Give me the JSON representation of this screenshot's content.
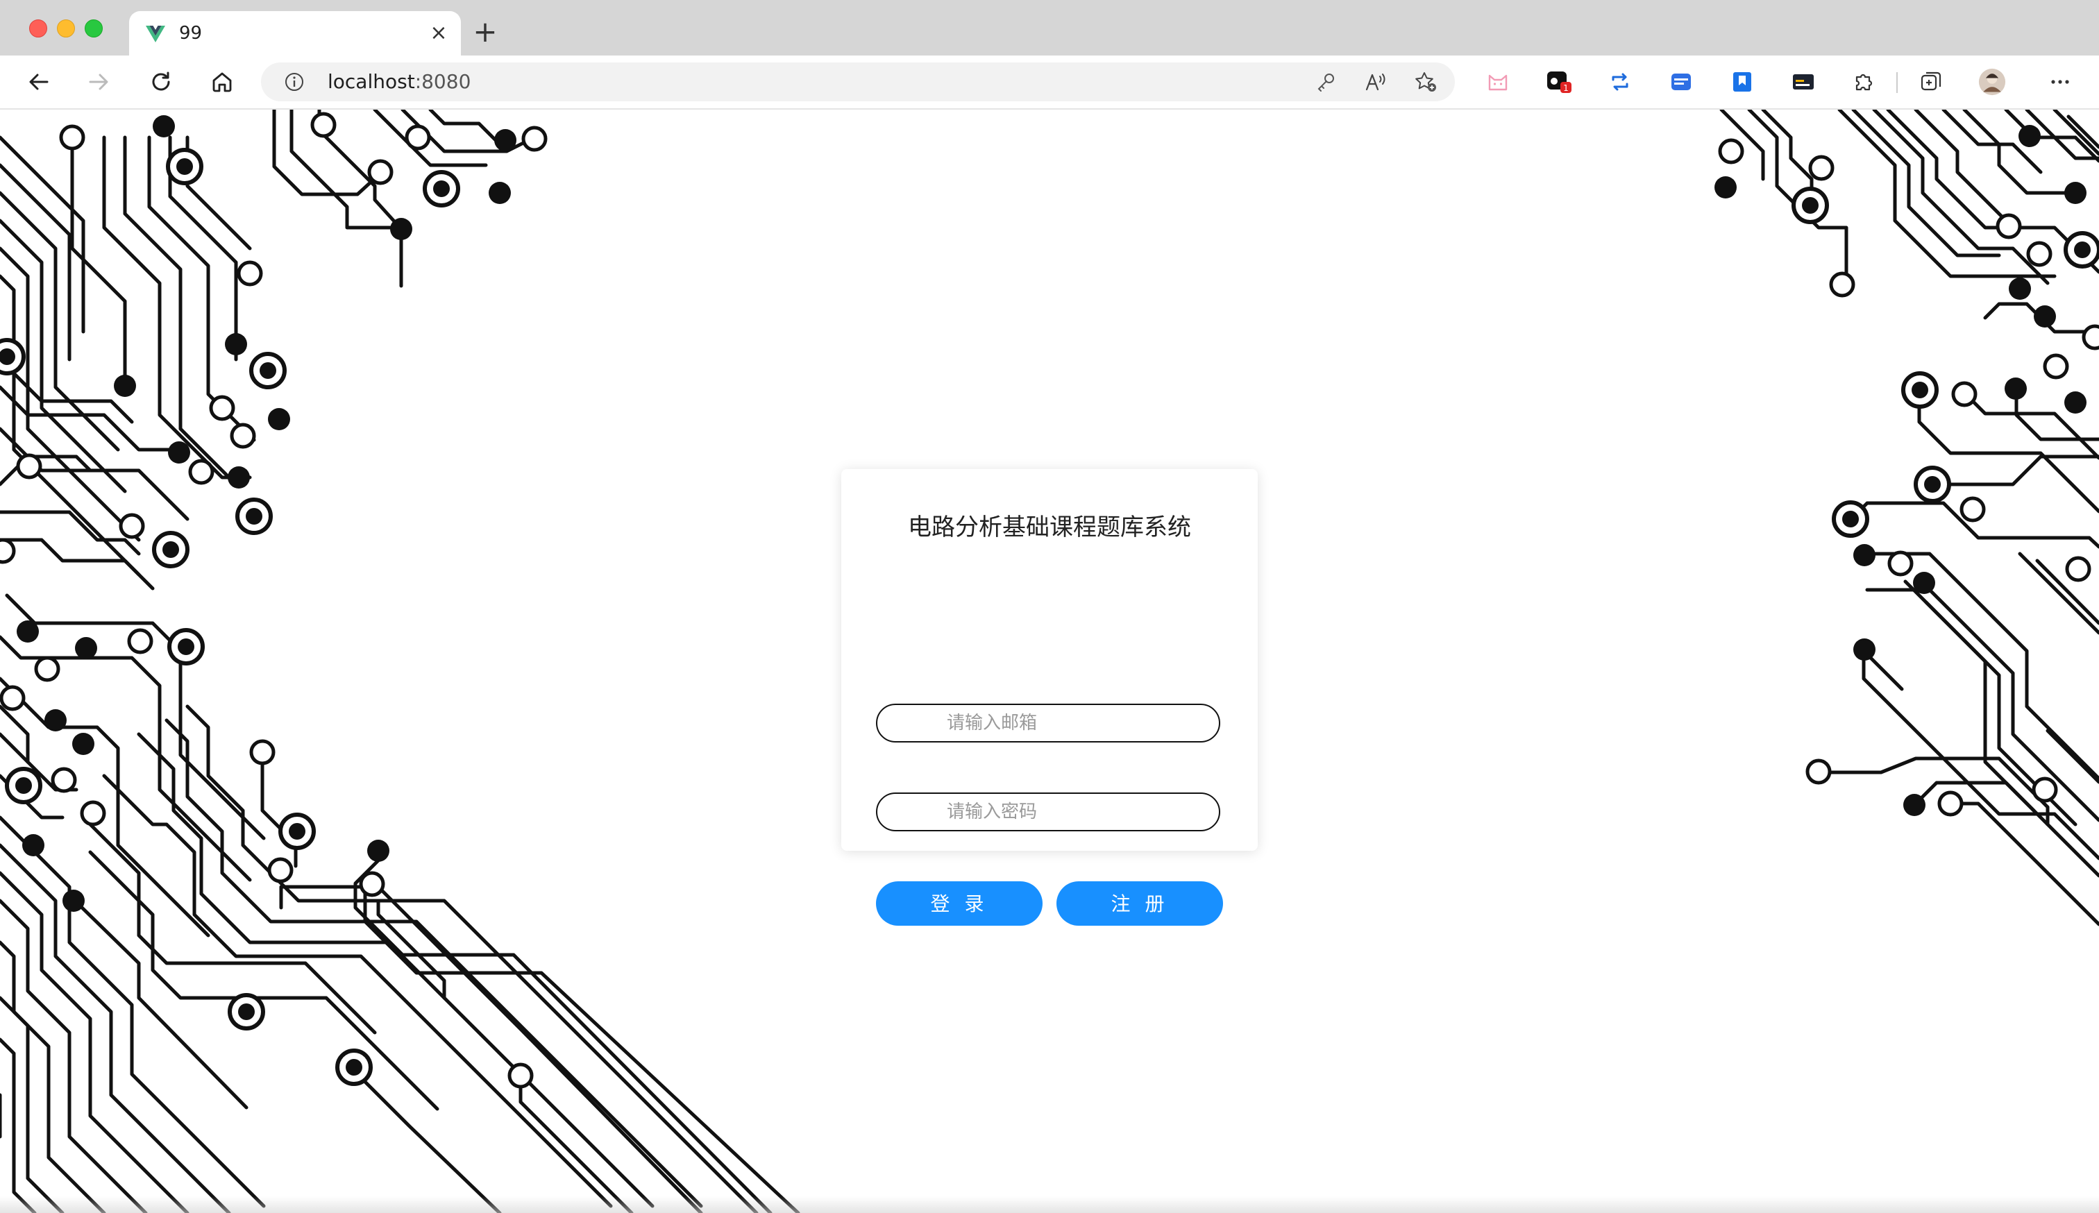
{
  "browser": {
    "tab": {
      "title": "99",
      "close_symbol": "×",
      "favicon": "vue-logo-icon"
    },
    "new_tab_symbol": "+",
    "address": {
      "host": "localhost",
      "port": ":8080"
    },
    "toolbar_icons": [
      "back-arrow-icon",
      "forward-arrow-icon",
      "reload-icon",
      "home-icon",
      "info-icon",
      "key-icon",
      "read-aloud-icon",
      "favorite-star-icon"
    ],
    "extension_icons": [
      "cat-extension-icon",
      "extension-badge-icon",
      "repeat-extension-icon",
      "window-extension-icon",
      "bookmark-extension-icon",
      "terminal-extension-icon",
      "puzzle-extensions-icon",
      "collections-icon",
      "profile-avatar",
      "more-menu-icon"
    ],
    "extension_badge": "1"
  },
  "login": {
    "title": "电路分析基础课程题库系统",
    "email_placeholder": "请输入邮箱",
    "password_placeholder": "请输入密码",
    "login_label": "登 录",
    "register_label": "注 册"
  },
  "colors": {
    "primary": "#1890ff",
    "tab_strip": "#d6d6d6",
    "circuit": "#111111"
  }
}
